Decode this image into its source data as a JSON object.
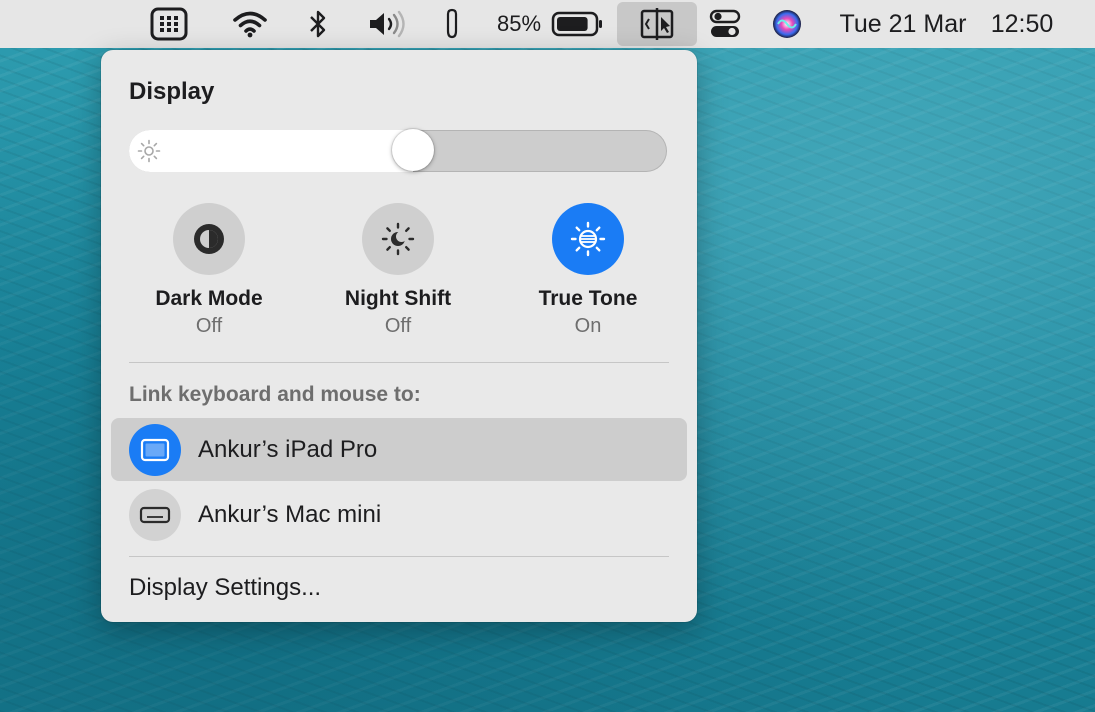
{
  "menubar": {
    "battery_percent": "85%",
    "battery_level": 0.85,
    "date": "Tue 21 Mar",
    "time": "12:50",
    "icons": [
      "keyboard-brightness-icon",
      "wifi-icon",
      "bluetooth-icon",
      "volume-icon",
      "paperclip-icon",
      "battery-icon",
      "display-icon",
      "control-center-icon",
      "siri-icon"
    ]
  },
  "panel": {
    "title": "Display",
    "brightness": 0.53,
    "toggles": [
      {
        "label": "Dark Mode",
        "state": "Off",
        "icon": "dark-mode-icon"
      },
      {
        "label": "Night Shift",
        "state": "Off",
        "icon": "night-shift-icon"
      },
      {
        "label": "True Tone",
        "state": "On",
        "icon": "true-tone-icon"
      }
    ],
    "link_heading": "Link keyboard and mouse to:",
    "devices": [
      {
        "label": "Ankur’s iPad Pro",
        "icon": "ipad-icon",
        "selected": true
      },
      {
        "label": "Ankur’s Mac mini",
        "icon": "mac-mini-icon",
        "selected": false
      }
    ],
    "settings_label": "Display Settings..."
  },
  "colors": {
    "accent": "#1a7cf5",
    "panel_bg": "#e9e9e9",
    "menubar_bg": "#e6e6e6"
  }
}
